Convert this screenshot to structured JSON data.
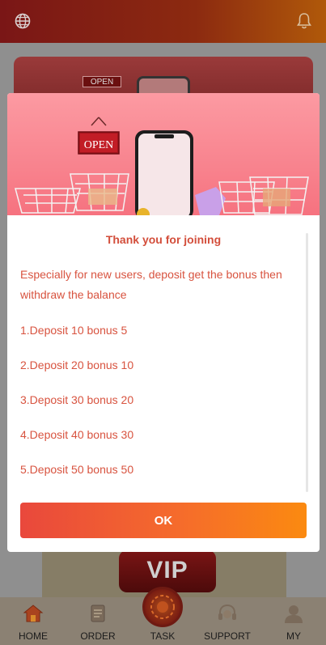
{
  "header": {
    "language_icon": "globe-icon",
    "notification_icon": "bell-icon"
  },
  "background": {
    "banner_sign": "OPEN",
    "vip_label": "VIP"
  },
  "modal": {
    "hero_sign": "OPEN",
    "title": "Thank you for joining",
    "description": "Especially for new users, deposit get the bonus then withdraw the balance",
    "bonuses": [
      "1.Deposit 10 bonus 5",
      "2.Deposit 20 bonus 10",
      "3.Deposit 30 bonus 20",
      "4.Deposit 40 bonus 30",
      "5.Deposit 50 bonus 50"
    ],
    "ok_label": "OK",
    "colors": {
      "text": "#d8533f",
      "button_start": "#e9483c",
      "button_end": "#fb8a10"
    }
  },
  "nav": {
    "items": [
      {
        "label": "HOME",
        "icon": "home-icon"
      },
      {
        "label": "ORDER",
        "icon": "order-icon"
      },
      {
        "label": "TASK",
        "icon": "task-icon"
      },
      {
        "label": "SUPPORT",
        "icon": "support-icon"
      },
      {
        "label": "MY",
        "icon": "user-icon"
      }
    ]
  }
}
